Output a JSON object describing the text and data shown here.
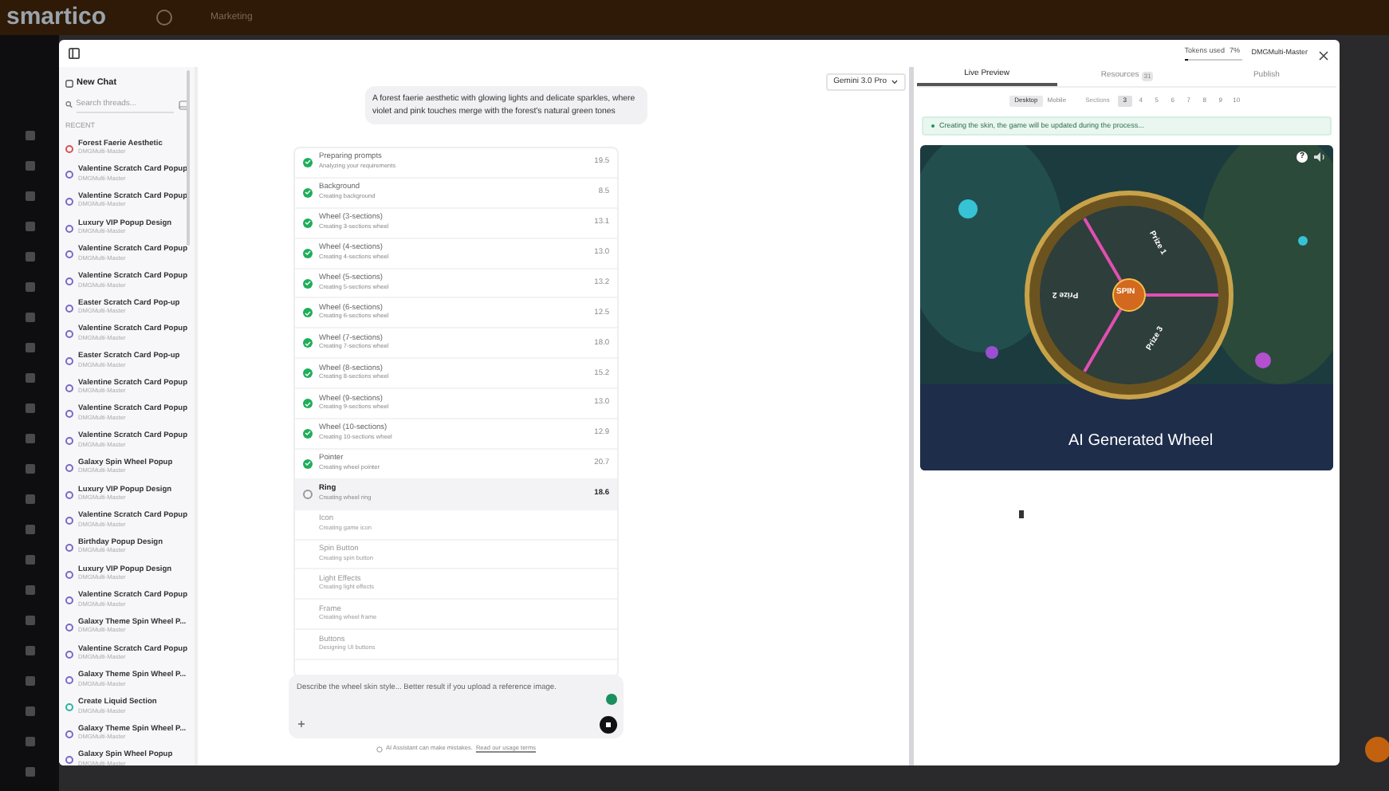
{
  "app": {
    "logo": "smartico",
    "nav": [
      "Marketing"
    ]
  },
  "sidebar": {
    "new_chat": "New Chat",
    "search_placeholder": "Search threads...",
    "section": "RECENT",
    "threads": [
      {
        "title": "Forest Faerie Aesthetic",
        "owner": "DMGMulti-Master",
        "color": "#d9534f"
      },
      {
        "title": "Valentine Scratch Card Popup",
        "owner": "DMGMulti-Master",
        "color": "#7b68c9"
      },
      {
        "title": "Valentine Scratch Card Popup",
        "owner": "DMGMulti-Master",
        "color": "#7b68c9"
      },
      {
        "title": "Luxury VIP Popup Design",
        "owner": "DMGMulti-Master",
        "color": "#7b68c9"
      },
      {
        "title": "Valentine Scratch Card Popup",
        "owner": "DMGMulti-Master",
        "color": "#7b68c9"
      },
      {
        "title": "Valentine Scratch Card Popup",
        "owner": "DMGMulti-Master",
        "color": "#7b68c9"
      },
      {
        "title": "Easter Scratch Card Pop-up",
        "owner": "DMGMulti-Master",
        "color": "#7b68c9"
      },
      {
        "title": "Valentine Scratch Card Popup",
        "owner": "DMGMulti-Master",
        "color": "#7b68c9"
      },
      {
        "title": "Easter Scratch Card Pop-up",
        "owner": "DMGMulti-Master",
        "color": "#7b68c9"
      },
      {
        "title": "Valentine Scratch Card Popup",
        "owner": "DMGMulti-Master",
        "color": "#7b68c9"
      },
      {
        "title": "Valentine Scratch Card Popup",
        "owner": "DMGMulti-Master",
        "color": "#7b68c9"
      },
      {
        "title": "Valentine Scratch Card Popup",
        "owner": "DMGMulti-Master",
        "color": "#7b68c9"
      },
      {
        "title": "Galaxy Spin Wheel Popup",
        "owner": "DMGMulti-Master",
        "color": "#7b68c9"
      },
      {
        "title": "Luxury VIP Popup Design",
        "owner": "DMGMulti-Master",
        "color": "#7b68c9"
      },
      {
        "title": "Valentine Scratch Card Popup",
        "owner": "DMGMulti-Master",
        "color": "#7b68c9"
      },
      {
        "title": "Birthday Popup Design",
        "owner": "DMGMulti-Master",
        "color": "#7b68c9"
      },
      {
        "title": "Luxury VIP Popup Design",
        "owner": "DMGMulti-Master",
        "color": "#7b68c9"
      },
      {
        "title": "Valentine Scratch Card Popup",
        "owner": "DMGMulti-Master",
        "color": "#7b68c9"
      },
      {
        "title": "Galaxy Theme Spin Wheel P...",
        "owner": "DMGMulti-Master",
        "color": "#7b68c9"
      },
      {
        "title": "Valentine Scratch Card Popup",
        "owner": "DMGMulti-Master",
        "color": "#7b68c9"
      },
      {
        "title": "Galaxy Theme Spin Wheel P...",
        "owner": "DMGMulti-Master",
        "color": "#7b68c9"
      },
      {
        "title": "Create Liquid Section",
        "owner": "DMGMulti-Master",
        "color": "#2bb3a3"
      },
      {
        "title": "Galaxy Theme Spin Wheel P...",
        "owner": "DMGMulti-Master",
        "color": "#7b68c9"
      },
      {
        "title": "Galaxy Spin Wheel Popup",
        "owner": "DMGMulti-Master",
        "color": "#7b68c9"
      }
    ]
  },
  "chat": {
    "model": "Gemini 3.0 Pro",
    "message": "A forest faerie aesthetic with glowing lights and delicate sparkles, where violet and pink touches merge with the forest's natural green tones",
    "steps": [
      {
        "name": "Preparing prompts",
        "detail": "Analyzing your requirements",
        "time": "19.5",
        "kind": "done"
      },
      {
        "name": "Background",
        "detail": "Creating background",
        "time": "8.5",
        "kind": "done"
      },
      {
        "name": "Wheel (3-sections)",
        "detail": "Creating 3-sections wheel",
        "time": "13.1",
        "kind": "done"
      },
      {
        "name": "Wheel (4-sections)",
        "detail": "Creating 4-sections wheel",
        "time": "13.0",
        "kind": "done"
      },
      {
        "name": "Wheel (5-sections)",
        "detail": "Creating 5-sections wheel",
        "time": "13.2",
        "kind": "done"
      },
      {
        "name": "Wheel (6-sections)",
        "detail": "Creating 6-sections wheel",
        "time": "12.5",
        "kind": "done"
      },
      {
        "name": "Wheel (7-sections)",
        "detail": "Creating 7-sections wheel",
        "time": "18.0",
        "kind": "done"
      },
      {
        "name": "Wheel (8-sections)",
        "detail": "Creating 8-sections wheel",
        "time": "15.2",
        "kind": "done"
      },
      {
        "name": "Wheel (9-sections)",
        "detail": "Creating 9-sections wheel",
        "time": "13.0",
        "kind": "done"
      },
      {
        "name": "Wheel (10-sections)",
        "detail": "Creating 10-sections wheel",
        "time": "12.9",
        "kind": "done"
      },
      {
        "name": "Pointer",
        "detail": "Creating wheel pointer",
        "time": "20.7",
        "kind": "done"
      },
      {
        "name": "Ring",
        "detail": "Creating wheel ring",
        "time": "18.6",
        "kind": "active"
      },
      {
        "name": "Icon",
        "detail": "Creating game icon",
        "kind": "pending"
      },
      {
        "name": "Spin Button",
        "detail": "Creating spin button",
        "kind": "pending"
      },
      {
        "name": "Light Effects",
        "detail": "Creating light effects",
        "kind": "pending"
      },
      {
        "name": "Frame",
        "detail": "Creating wheel frame",
        "kind": "pending"
      },
      {
        "name": "Buttons",
        "detail": "Designing UI buttons",
        "kind": "pending"
      }
    ],
    "input_placeholder": "Describe the wheel skin style... Better result if you upload a reference image.",
    "disclaimer": "AI Assistant can make mistakes.",
    "disclaimer_link": "Read our usage terms"
  },
  "preview": {
    "tokens_label": "Tokens used",
    "tokens_value": "7%",
    "tokens": {
      "level": 0.07
    },
    "user": "DMGMulti-Master",
    "tabs": [
      {
        "label": "Live Preview",
        "selected": true
      },
      {
        "label": "Resources",
        "badge": "31",
        "selected": false
      },
      {
        "label": "Publish",
        "selected": false
      }
    ],
    "devices": [
      {
        "label": "Desktop",
        "selected": true
      },
      {
        "label": "Mobile",
        "selected": false
      }
    ],
    "sections_label": "Sections",
    "sections": [
      {
        "label": "3",
        "selected": true
      },
      {
        "label": "4",
        "selected": false
      },
      {
        "label": "5",
        "selected": false
      },
      {
        "label": "6",
        "selected": false
      },
      {
        "label": "7",
        "selected": false
      },
      {
        "label": "8",
        "selected": false
      },
      {
        "label": "9",
        "selected": false
      },
      {
        "label": "10",
        "selected": false
      }
    ],
    "notice": "Creating the skin, the game will be updated during the process...",
    "game": {
      "help": "?",
      "prizes": [
        "Prize 1",
        "Prize 2",
        "Prize 3"
      ],
      "spin": "SPIN",
      "caption": "AI Generated Wheel"
    }
  }
}
